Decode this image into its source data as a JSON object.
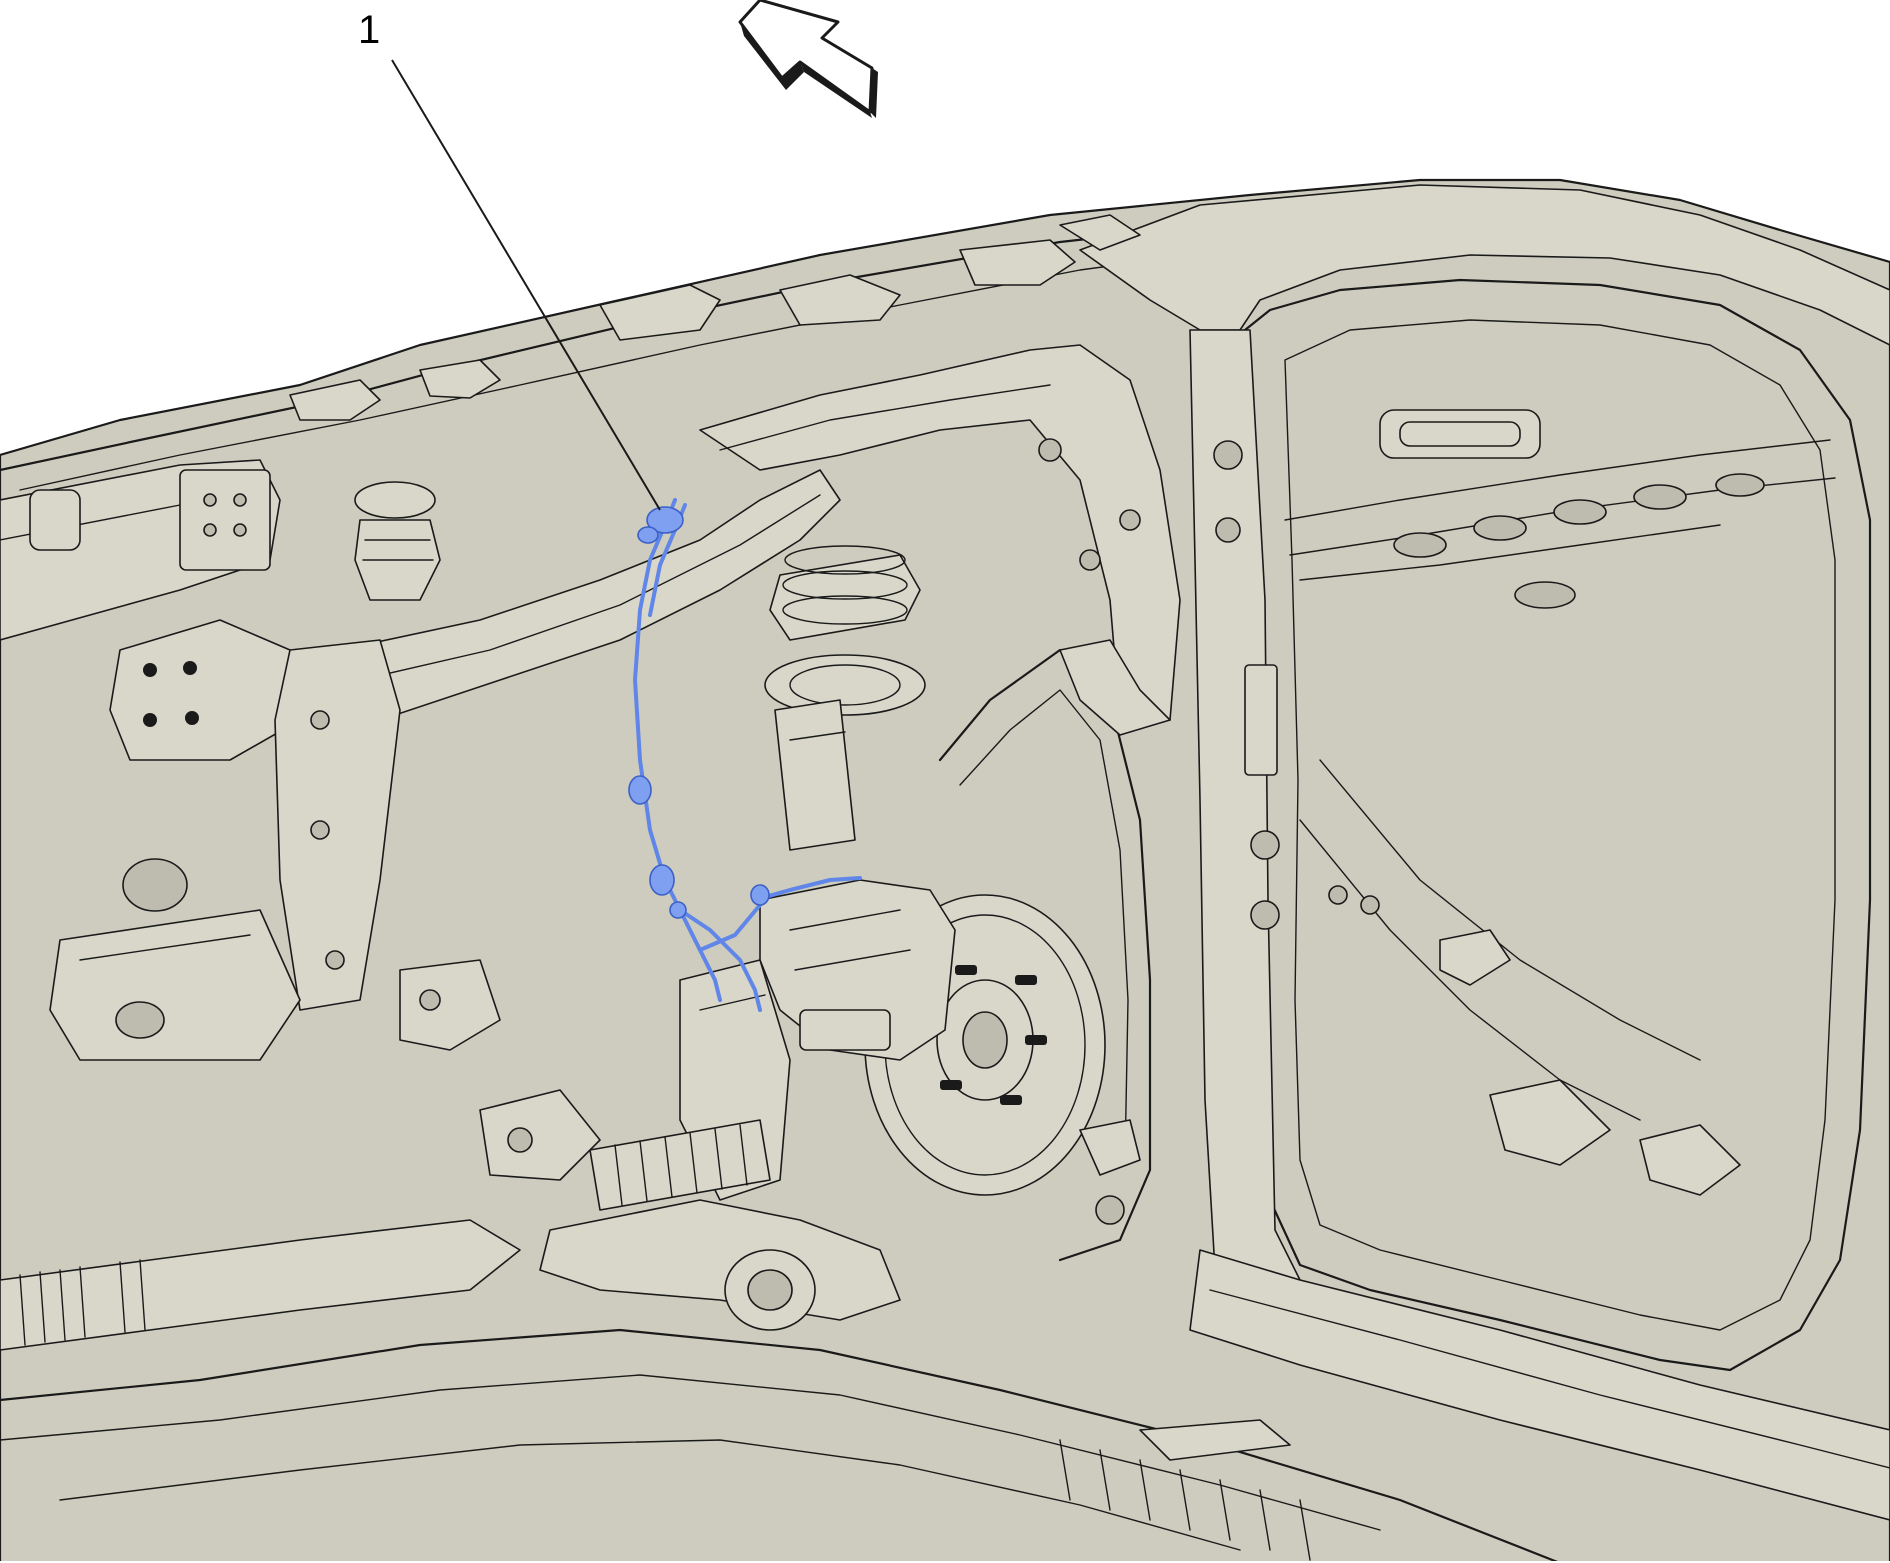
{
  "callout": {
    "number": "1"
  },
  "colors": {
    "body_fill": "#cdccbe",
    "highlight": "#5f86e8",
    "line": "#1a1a1a"
  },
  "icons": {
    "direction_arrow": "arrow-icon"
  }
}
